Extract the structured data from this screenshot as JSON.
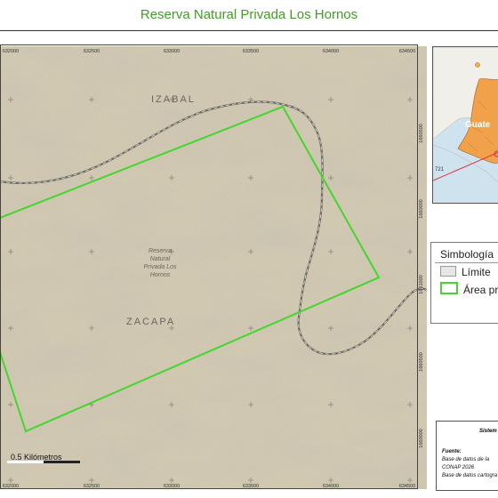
{
  "title": "Reserva Natural Privada Los Hornos",
  "map": {
    "x_ticks": [
      "632000",
      "632500",
      "633000",
      "633500",
      "634000",
      "634500"
    ],
    "y_ticks": [
      "1660500",
      "1660000",
      "1661000",
      "1660500",
      "1660000"
    ],
    "labels": {
      "north_dept": "IZABAL",
      "south_dept": "ZACAPA",
      "reserve_line1": "Reserva",
      "reserve_line2": "Natural",
      "reserve_line3": "Privada Los",
      "reserve_line4": "Hornos"
    },
    "scale_label": "0.5 Kilómetros",
    "colors": {
      "terrain": "#cfc6ad",
      "reserve_outline": "#44d62c",
      "boundary": "#6d6a64"
    }
  },
  "inset": {
    "country_label": "Guate",
    "callout_label": "721"
  },
  "legend": {
    "title": "Simbología",
    "items": [
      {
        "label": "Límite"
      },
      {
        "label": "Área pr"
      }
    ]
  },
  "info": {
    "system": "Sistem",
    "fuente": "Fuente:",
    "line1": "Base de datos de la",
    "line2": "CONAP 2026",
    "line3": "Base de datos cartogra"
  }
}
